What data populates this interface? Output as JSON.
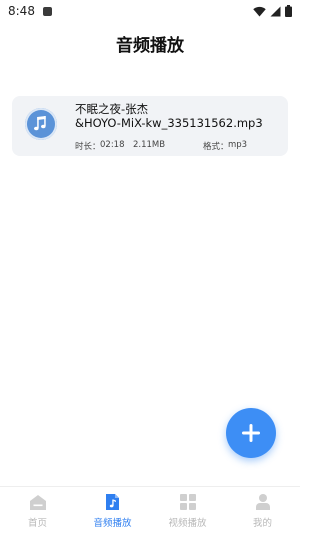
{
  "status_bar": {
    "time": "8:48"
  },
  "header": {
    "title": "音频播放"
  },
  "file": {
    "name_line1": "不眠之夜-张杰",
    "name_line2": "&HOYO-MiX-kw_335131562.mp3",
    "duration_label": "时长：",
    "duration": "02:18",
    "size": "2.11MB",
    "format_label": "格式：",
    "format": "mp3"
  },
  "nav": {
    "items": [
      {
        "label": "首页",
        "icon": "home-icon",
        "active": false
      },
      {
        "label": "音频播放",
        "icon": "music-file-icon",
        "active": true
      },
      {
        "label": "视频播放",
        "icon": "grid-icon",
        "active": false
      },
      {
        "label": "我的",
        "icon": "user-icon",
        "active": false
      }
    ]
  },
  "colors": {
    "accent": "#3d8ef5",
    "card_bg": "#f1f3f6",
    "nav_inactive": "#b8b8b8",
    "nav_active": "#2f7ff0"
  }
}
